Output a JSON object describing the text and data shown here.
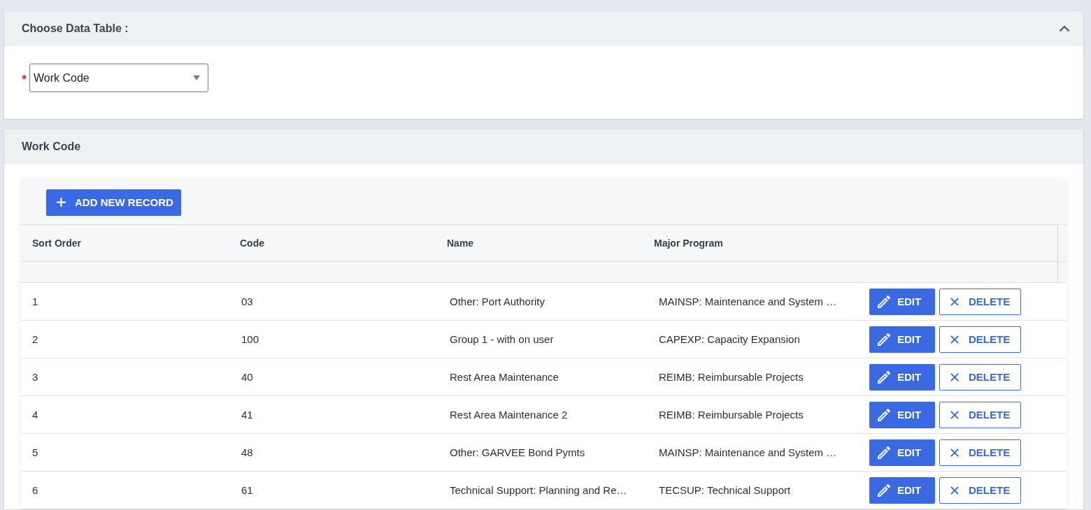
{
  "data_table_panel": {
    "title": "Choose Data Table :",
    "expanded": true,
    "field": {
      "required": true,
      "value": "Work Code"
    }
  },
  "grid_panel": {
    "title": "Work Code",
    "add_button": "ADD NEW RECORD",
    "table": {
      "columns": [
        "Sort Order",
        "Code",
        "Name",
        "Major Program"
      ],
      "rows": [
        {
          "cells": [
            "1",
            "03",
            "Other: Port Authority",
            "MAINSP: Maintenance and System …"
          ],
          "actions": [
            {
              "kind": "edit",
              "label": "EDIT"
            },
            {
              "kind": "delete",
              "label": "DELETE"
            }
          ]
        },
        {
          "cells": [
            "2",
            "100",
            "Group 1 - with on user",
            "CAPEXP: Capacity Expansion"
          ],
          "actions": [
            {
              "kind": "edit",
              "label": "EDIT"
            },
            {
              "kind": "delete",
              "label": "DELETE"
            }
          ]
        },
        {
          "cells": [
            "3",
            "40",
            "Rest Area Maintenance",
            "REIMB: Reimbursable Projects"
          ],
          "actions": [
            {
              "kind": "edit",
              "label": "EDIT"
            },
            {
              "kind": "delete",
              "label": "DELETE"
            }
          ]
        },
        {
          "cells": [
            "4",
            "41",
            "Rest Area Maintenance 2",
            "REIMB: Reimbursable Projects"
          ],
          "actions": [
            {
              "kind": "edit",
              "label": "EDIT"
            },
            {
              "kind": "delete",
              "label": "DELETE"
            }
          ]
        },
        {
          "cells": [
            "5",
            "48",
            "Other: GARVEE Bond Pymts",
            "MAINSP: Maintenance and System …"
          ],
          "actions": [
            {
              "kind": "edit",
              "label": "EDIT"
            },
            {
              "kind": "delete",
              "label": "DELETE"
            }
          ]
        },
        {
          "cells": [
            "6",
            "61",
            "Technical Support: Planning and Re…",
            "TECSUP: Technical Support"
          ],
          "actions": [
            {
              "kind": "edit",
              "label": "EDIT"
            },
            {
              "kind": "delete",
              "label": "DELETE"
            }
          ]
        }
      ]
    }
  }
}
